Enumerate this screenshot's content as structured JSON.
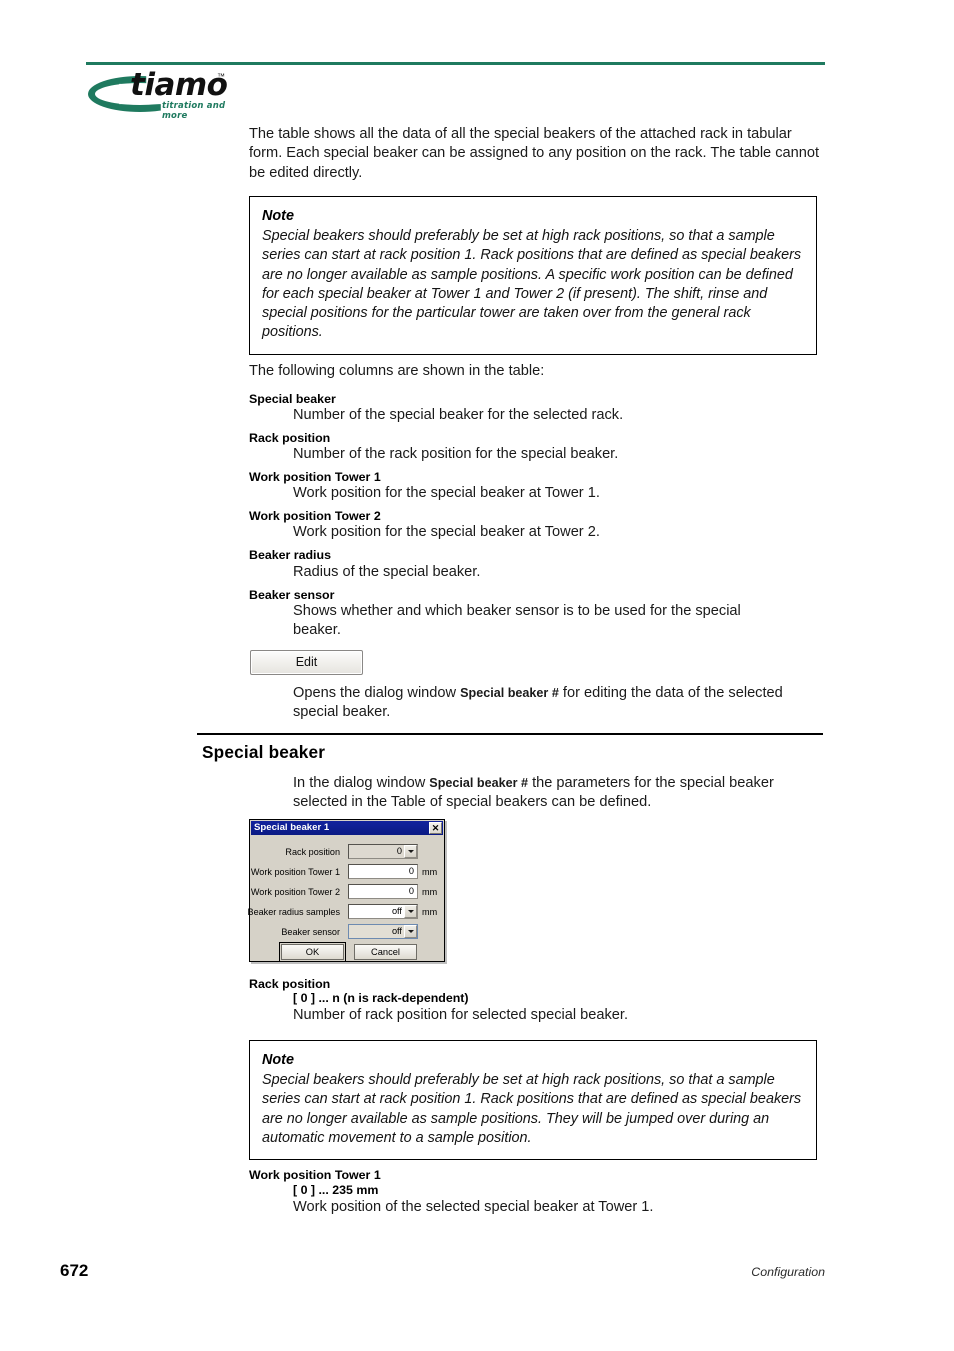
{
  "header": {
    "logo_word": "tiamo",
    "logo_trademark": "™",
    "logo_tagline": "titration and more",
    "rule_color": "#1f7a5f"
  },
  "intro": {
    "paragraph": "The table shows all the data of all the special beakers of the attached rack in tabular form. Each special beaker can be assigned to any position on the rack. The table cannot be edited directly."
  },
  "note_1": {
    "title": "Note",
    "body": "Special beakers should preferably be set at high rack positions, so that a sample series can start at rack position 1. Rack positions that are defined as special beakers are no longer available as sample positions. A specific work position can be defined for each special beaker at Tower 1 and Tower 2 (if present). The shift, rinse and special positions for the particular tower are taken over from the general rack positions."
  },
  "columns_intro": "The following columns are shown in the table:",
  "column_definitions": [
    {
      "term": "Special beaker",
      "definition": "Number of the special beaker for the selected rack."
    },
    {
      "term": "Rack position",
      "definition": "Number of the rack position for the special beaker."
    },
    {
      "term": "Work position Tower 1",
      "definition": "Work position for the special beaker at Tower 1."
    },
    {
      "term": "Work position Tower 2",
      "definition": "Work position for the special beaker at Tower 2."
    },
    {
      "term": "Beaker radius",
      "definition": "Radius of the special beaker."
    },
    {
      "term": "Beaker sensor",
      "definition": "Shows whether and which beaker sensor is to be used for the special beaker."
    }
  ],
  "edit_button": {
    "label": "Edit",
    "description_pre": "Opens the dialog window ",
    "description_bold": "Special beaker #",
    "description_post": " for editing the data of the selected special beaker."
  },
  "section": {
    "title": "Special beaker",
    "intro_pre": "In the dialog window ",
    "intro_bold": "Special beaker #",
    "intro_post": " the parameters for the special beaker selected in the Table of special beakers can be defined."
  },
  "dialog": {
    "title": "Special beaker 1",
    "close_label": "✕",
    "fields": [
      {
        "label": "Rack position",
        "value": "0",
        "unit": "",
        "type": "combo"
      },
      {
        "label": "Work position Tower 1",
        "value": "0",
        "unit": "mm",
        "type": "text"
      },
      {
        "label": "Work position Tower 2",
        "value": "0",
        "unit": "mm",
        "type": "text"
      },
      {
        "label": "Beaker radius samples",
        "value": "off",
        "unit": "mm",
        "type": "combo"
      },
      {
        "label": "Beaker sensor",
        "value": "off",
        "unit": "",
        "type": "combo"
      }
    ],
    "ok_label": "OK",
    "cancel_label": "Cancel"
  },
  "param_definitions": [
    {
      "term": "Rack position",
      "range": "[ 0 ] ... n (n is rack-dependent)",
      "definition": "Number of rack position for selected special beaker."
    },
    {
      "term": "Work position Tower 1",
      "range": "[ 0 ] ... 235 mm",
      "definition": "Work position of the selected special beaker at Tower 1."
    }
  ],
  "note_2": {
    "title": "Note",
    "body": "Special beakers should preferably be set at high rack positions, so that a sample series can start at rack position 1. Rack positions that are defined as special beakers are no longer available as sample positions. They will be jumped over during an automatic movement to a sample position."
  },
  "footer": {
    "page_number": "672",
    "chapter": "Configuration"
  }
}
